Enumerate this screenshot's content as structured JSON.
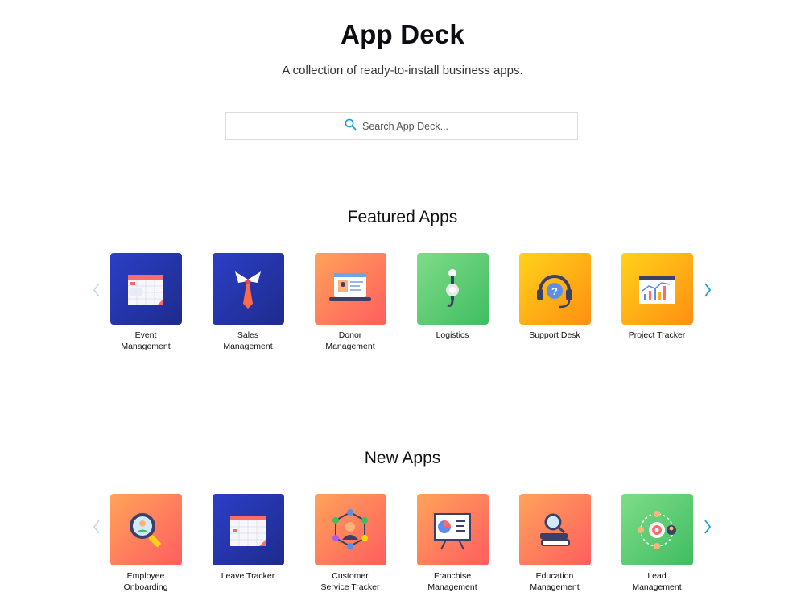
{
  "header": {
    "title": "App Deck",
    "subtitle": "A collection of ready-to-install business apps."
  },
  "search": {
    "placeholder": "Search App Deck..."
  },
  "featured": {
    "heading": "Featured Apps",
    "apps": [
      {
        "label": "Event Management",
        "icon": "calendar-icon",
        "color": "#2535a8"
      },
      {
        "label": "Sales Management",
        "icon": "necktie-icon",
        "color": "#2535a8"
      },
      {
        "label": "Donor Management",
        "icon": "laptop-profile-icon",
        "color": "#ff7f5c"
      },
      {
        "label": "Logistics",
        "icon": "crane-hook-icon",
        "color": "#5fcd74"
      },
      {
        "label": "Support Desk",
        "icon": "headset-icon",
        "color": "#ffb014"
      },
      {
        "label": "Project Tracker",
        "icon": "chart-window-icon",
        "color": "#ffb014"
      }
    ]
  },
  "new": {
    "heading": "New Apps",
    "apps": [
      {
        "label": "Employee Onboarding",
        "icon": "magnifier-person-icon",
        "color": "#ff7f5c"
      },
      {
        "label": "Leave Tracker",
        "icon": "calendar-icon",
        "color": "#2535a8"
      },
      {
        "label": "Customer Service Tracker",
        "icon": "network-agent-icon",
        "color": "#ff7f5c"
      },
      {
        "label": "Franchise Management",
        "icon": "presentation-board-icon",
        "color": "#ff7f5c"
      },
      {
        "label": "Education Management",
        "icon": "books-magnifier-icon",
        "color": "#ff7f5c"
      },
      {
        "label": "Lead Management",
        "icon": "target-people-icon",
        "color": "#5fcd74"
      }
    ]
  },
  "colors": {
    "accent": "#1aa3c8",
    "arrow_disabled": "#b9dde9"
  }
}
